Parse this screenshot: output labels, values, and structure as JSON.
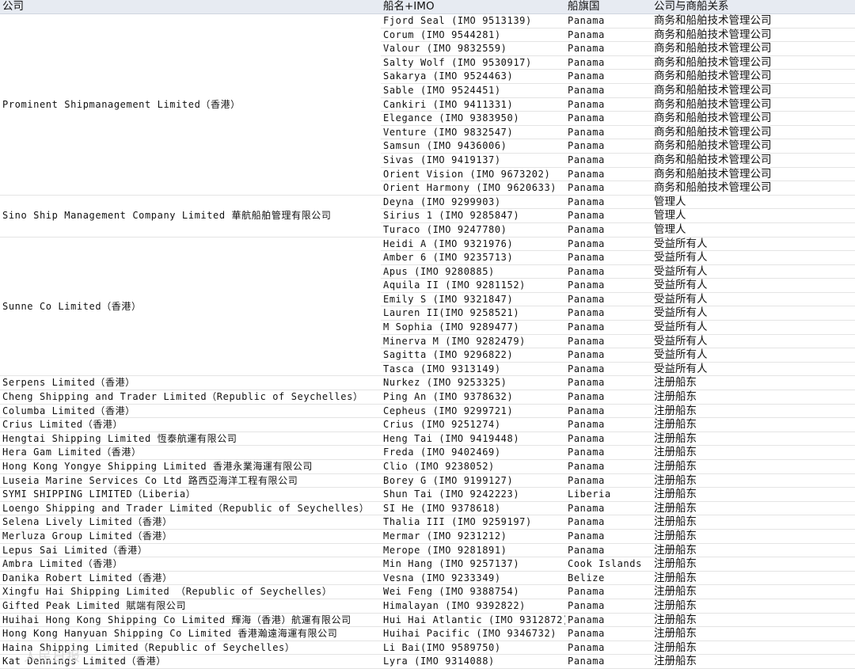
{
  "headers": [
    "公司",
    "船名+IMO",
    "船旗国",
    "公司与商船关系"
  ],
  "groups": [
    {
      "company": "Prominent Shipmanagement Limited（香港）",
      "rows": [
        [
          "Fjord Seal (IMO 9513139)",
          "Panama",
          "商务和船舶技术管理公司"
        ],
        [
          "Corum (IMO 9544281)",
          "Panama",
          "商务和船舶技术管理公司"
        ],
        [
          "Valour (IMO 9832559)",
          "Panama",
          "商务和船舶技术管理公司"
        ],
        [
          "Salty Wolf (IMO 9530917)",
          "Panama",
          "商务和船舶技术管理公司"
        ],
        [
          "Sakarya (IMO 9524463)",
          "Panama",
          "商务和船舶技术管理公司"
        ],
        [
          "Sable (IMO 9524451)",
          "Panama",
          "商务和船舶技术管理公司"
        ],
        [
          "Cankiri (IMO 9411331)",
          "Panama",
          "商务和船舶技术管理公司"
        ],
        [
          "Elegance (IMO 9383950)",
          "Panama",
          "商务和船舶技术管理公司"
        ],
        [
          "Venture (IMO 9832547)",
          "Panama",
          "商务和船舶技术管理公司"
        ],
        [
          "Samsun (IMO 9436006)",
          "Panama",
          "商务和船舶技术管理公司"
        ],
        [
          "Sivas (IMO 9419137)",
          "Panama",
          "商务和船舶技术管理公司"
        ],
        [
          "Orient Vision (IMO 9673202)",
          "Panama",
          "商务和船舶技术管理公司"
        ],
        [
          "Orient Harmony (IMO 9620633)",
          "Panama",
          "商务和船舶技术管理公司"
        ]
      ]
    },
    {
      "company": "Sino Ship Management Company Limited 華航船舶管理有限公司",
      "rows": [
        [
          "Deyna (IMO 9299903)",
          "Panama",
          "管理人"
        ],
        [
          "Sirius 1 (IMO 9285847)",
          "Panama",
          "管理人"
        ],
        [
          "Turaco (IMO 9247780)",
          "Panama",
          "管理人"
        ]
      ]
    },
    {
      "company": "Sunne Co Limited（香港）",
      "rows": [
        [
          "Heidi A (IMO 9321976)",
          "Panama",
          "受益所有人"
        ],
        [
          "Amber 6 (IMO 9235713)",
          "Panama",
          "受益所有人"
        ],
        [
          "Apus (IMO 9280885)",
          "Panama",
          "受益所有人"
        ],
        [
          "Aquila II (IMO 9281152)",
          "Panama",
          "受益所有人"
        ],
        [
          "Emily S (IMO 9321847)",
          "Panama",
          "受益所有人"
        ],
        [
          "Lauren II(IMO 9258521)",
          "Panama",
          "受益所有人"
        ],
        [
          "M Sophia (IMO 9289477)",
          "Panama",
          "受益所有人"
        ],
        [
          "Minerva M (IMO 9282479)",
          "Panama",
          "受益所有人"
        ],
        [
          "Sagitta (IMO 9296822)",
          "Panama",
          "受益所有人"
        ],
        [
          "Tasca (IMO 9313149)",
          "Panama",
          "受益所有人"
        ]
      ]
    },
    {
      "company": "Serpens Limited（香港）",
      "rows": [
        [
          "Nurkez (IMO 9253325)",
          "Panama",
          "注册船东"
        ]
      ]
    },
    {
      "company": "Cheng Shipping and Trader Limited（Republic of Seychelles）",
      "rows": [
        [
          "Ping An (IMO 9378632)",
          "Panama",
          "注册船东"
        ]
      ]
    },
    {
      "company": "Columba Limited（香港）",
      "rows": [
        [
          "Cepheus (IMO 9299721)",
          "Panama",
          "注册船东"
        ]
      ]
    },
    {
      "company": "Crius Limited（香港）",
      "rows": [
        [
          "Crius (IMO 9251274)",
          "Panama",
          "注册船东"
        ]
      ]
    },
    {
      "company": "Hengtai Shipping Limited 恆泰航運有限公司",
      "rows": [
        [
          "Heng Tai (IMO 9419448)",
          "Panama",
          "注册船东"
        ]
      ]
    },
    {
      "company": "Hera Gam Limited（香港）",
      "rows": [
        [
          "Freda (IMO 9402469)",
          "Panama",
          "注册船东"
        ]
      ]
    },
    {
      "company": "Hong Kong Yongye Shipping Limited 香港永業海運有限公司",
      "rows": [
        [
          "Clio (IMO 9238052)",
          "Panama",
          "注册船东"
        ]
      ]
    },
    {
      "company": "Luseia Marine Services Co Ltd 路西亞海洋工程有限公司",
      "rows": [
        [
          "Borey G (IMO 9199127)",
          "Panama",
          "注册船东"
        ]
      ]
    },
    {
      "company": "SYMI SHIPPING LIMITED（Liberia）",
      "rows": [
        [
          "Shun Tai (IMO 9242223)",
          "Liberia",
          "注册船东"
        ]
      ]
    },
    {
      "company": "Loengo Shipping and Trader Limited（Republic of Seychelles）",
      "rows": [
        [
          "SI He (IMO 9378618)",
          "Panama",
          "注册船东"
        ]
      ]
    },
    {
      "company": "Selena Lively Limited（香港）",
      "rows": [
        [
          "Thalia III (IMO 9259197)",
          "Panama",
          "注册船东"
        ]
      ]
    },
    {
      "company": "Merluza Group Limited（香港）",
      "rows": [
        [
          "Mermar (IMO 9231212)",
          "Panama",
          "注册船东"
        ]
      ]
    },
    {
      "company": "Lepus Sai Limited（香港）",
      "rows": [
        [
          "Merope (IMO 9281891)",
          "Panama",
          "注册船东"
        ]
      ]
    },
    {
      "company": "Ambra Limited（香港）",
      "rows": [
        [
          "Min Hang (IMO 9257137)",
          "Cook Islands",
          "注册船东"
        ]
      ]
    },
    {
      "company": "Danika Robert Limited（香港）",
      "rows": [
        [
          "Vesna (IMO 9233349)",
          "Belize",
          "注册船东"
        ]
      ]
    },
    {
      "company": "Xingfu Hai Shipping Limited （Republic of Seychelles）",
      "rows": [
        [
          "Wei Feng (IMO 9388754)",
          "Panama",
          "注册船东"
        ]
      ]
    },
    {
      "company": "Gifted Peak Limited 賦端有限公司",
      "rows": [
        [
          "Himalayan (IMO 9392822)",
          "Panama",
          "注册船东"
        ]
      ]
    },
    {
      "company": "Huihai Hong Kong Shipping Co Limited 輝海（香港）航運有限公司",
      "rows": [
        [
          "Hui Hai Atlantic (IMO 9312872)",
          "Panama",
          "注册船东"
        ]
      ]
    },
    {
      "company": "Hong Kong Hanyuan Shipping Co Limited 香港瀚遠海運有限公司",
      "rows": [
        [
          "Huihai Pacific (IMO 9346732)",
          "Panama",
          "注册船东"
        ]
      ]
    },
    {
      "company": "Haina Shipping Limited（Republic of Seychelles）",
      "rows": [
        [
          "Li Bai(IMO 9589750)",
          "Panama",
          "注册船东"
        ]
      ]
    },
    {
      "company": "Kat Dennings Limited（香港）",
      "rows": [
        [
          "Lyra (IMO 9314088)",
          "Panama",
          "注册船东"
        ]
      ]
    }
  ],
  "watermark": "人民日报"
}
